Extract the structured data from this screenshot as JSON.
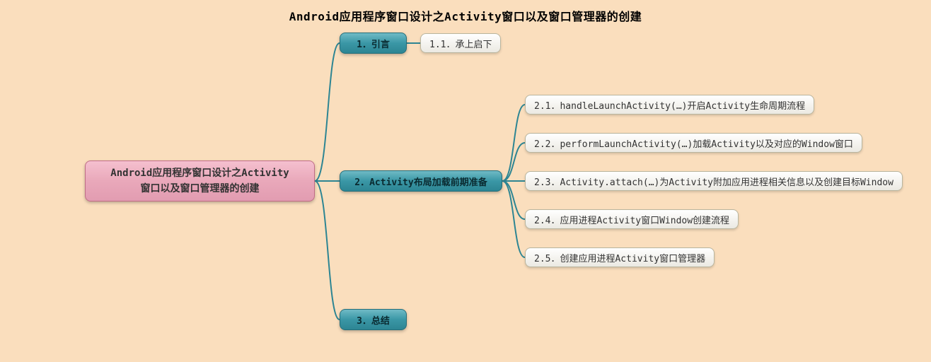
{
  "title": "Android应用程序窗口设计之Activity窗口以及窗口管理器的创建",
  "root": {
    "label": "Android应用程序窗口设计之Activity\n窗口以及窗口管理器的创建"
  },
  "branches": [
    {
      "id": "b1",
      "label": "1．引言"
    },
    {
      "id": "b2",
      "label": "2．Activity布局加载前期准备"
    },
    {
      "id": "b3",
      "label": "3．总结"
    }
  ],
  "leaves_b1": [
    {
      "label": "1.1．承上启下"
    }
  ],
  "leaves_b2": [
    {
      "label": "2.1．handleLaunchActivity(…)开启Activity生命周期流程"
    },
    {
      "label": "2.2．performLaunchActivity(…)加载Activity以及对应的Window窗口"
    },
    {
      "label": "2.3．Activity.attach(…)为Activity附加应用进程相关信息以及创建目标Window"
    },
    {
      "label": "2.4．应用进程Activity窗口Window创建流程"
    },
    {
      "label": "2.5．创建应用进程Activity窗口管理器"
    }
  ]
}
